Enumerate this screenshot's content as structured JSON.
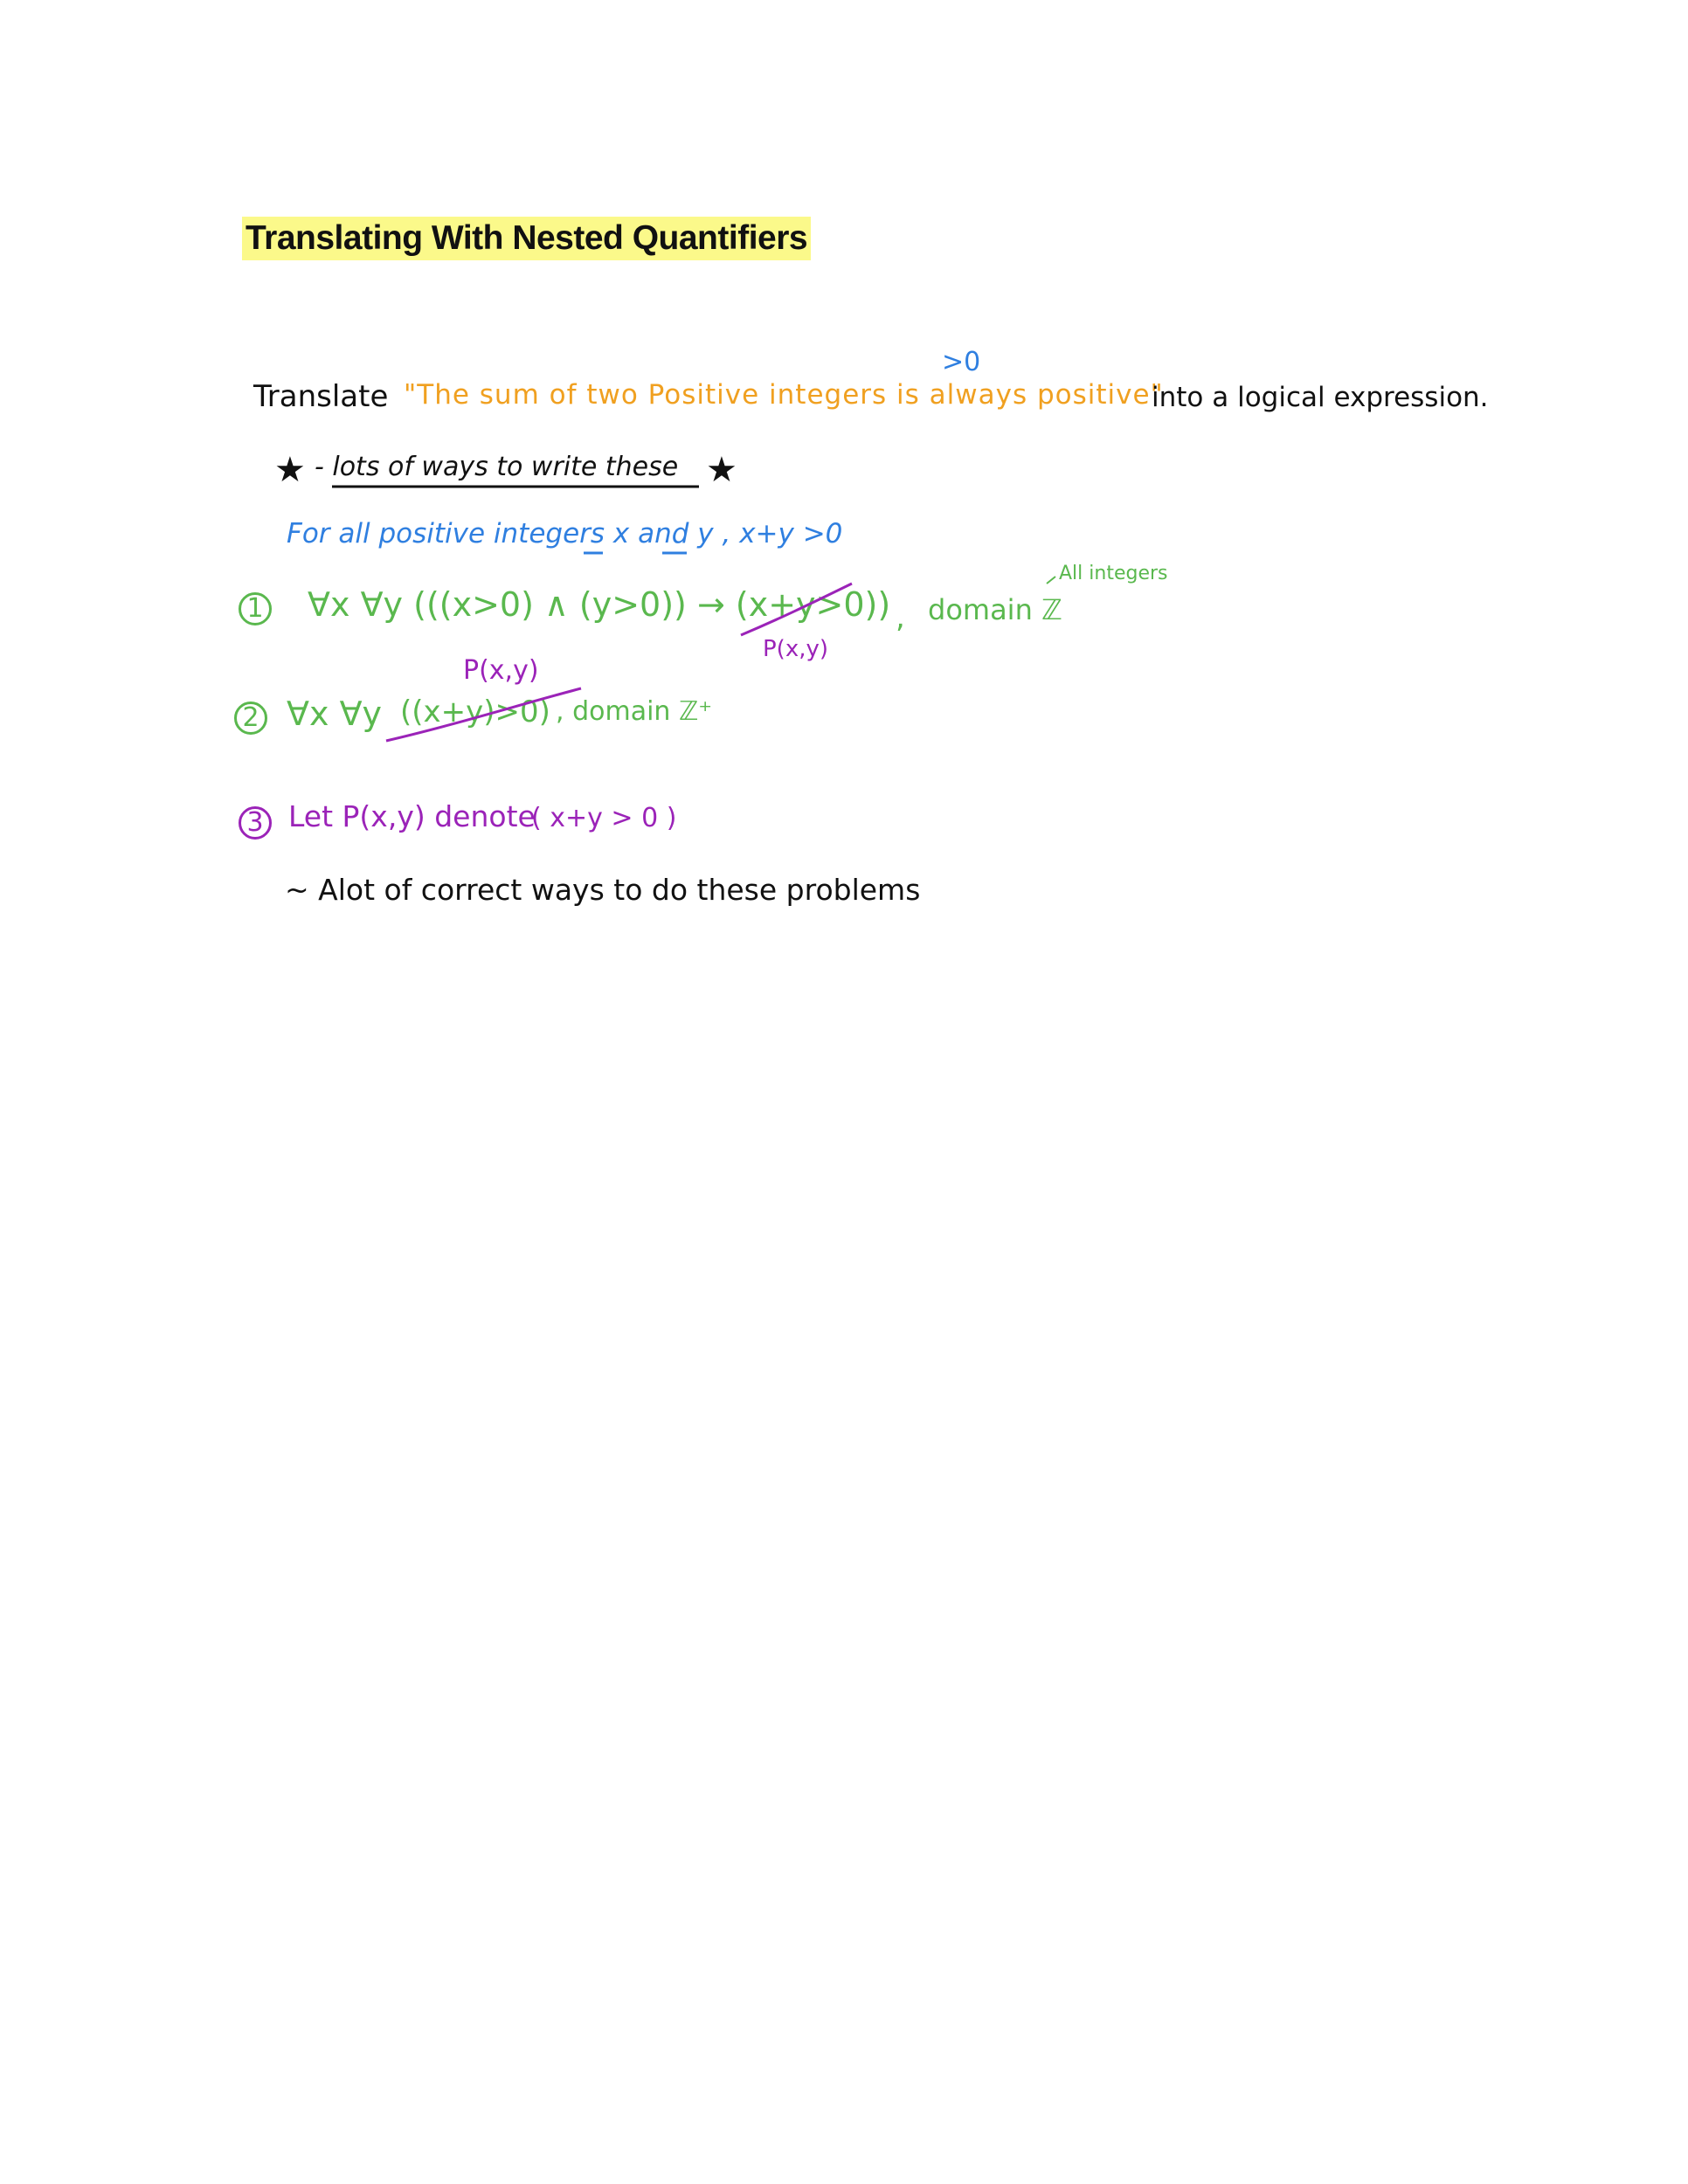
{
  "title": "Translating With Nested Quantifiers",
  "colors": {
    "highlight": "#fbf98a",
    "black": "#111111",
    "orange": "#f0a020",
    "blue": "#2f7fe0",
    "green": "#5ab84e",
    "purple": "#9b23b8"
  },
  "problem": {
    "lead": "Translate",
    "quote": "\"The sum of two Positive integers is always positive\"",
    "annotation": ">0",
    "tail": "into a logical expression."
  },
  "note": {
    "text": "- lots of ways to write these",
    "star_icon": "star-icon"
  },
  "restatement": "For all positive integers x and y , x+y >0",
  "option1": {
    "number": "1",
    "formula": "∀x ∀y (((x>0) ∧ (y>0)) → (x+y>0))",
    "comma": ",",
    "domain": "domain ℤ",
    "domain_note": "All integers",
    "crossed_label": "P(x,y)"
  },
  "option2": {
    "number": "2",
    "formula": "∀x ∀y",
    "crossed": "((x+y)>0)",
    "domain": ", domain ℤ⁺",
    "crossed_label": "P(x,y)"
  },
  "option3": {
    "number": "3",
    "text": "Let P(x,y) denote",
    "formula": "( x+y > 0 )"
  },
  "remark": "~ Alot of correct ways to do these problems"
}
